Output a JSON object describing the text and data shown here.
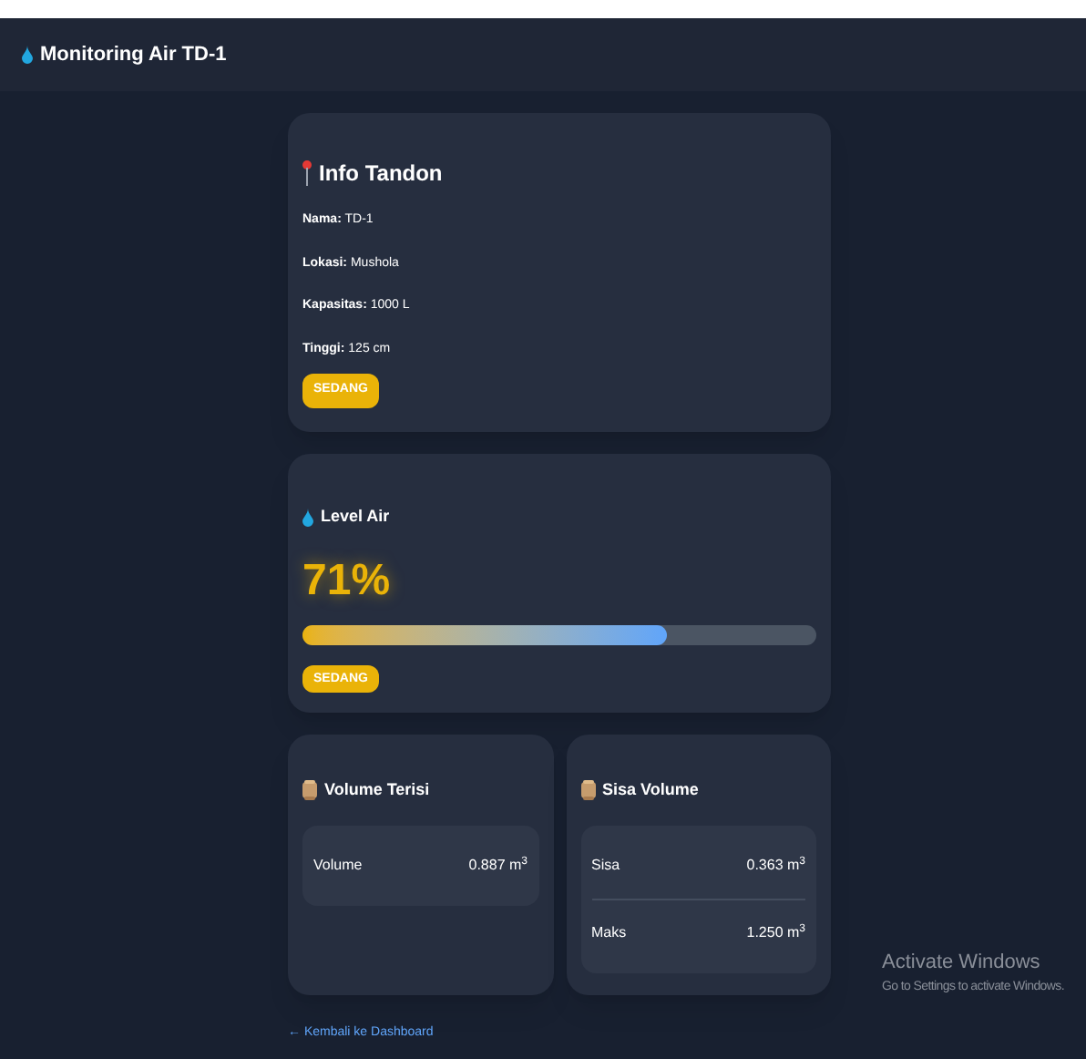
{
  "header": {
    "title": "Monitoring Air TD-1"
  },
  "info": {
    "title": "Info Tandon",
    "fields": [
      {
        "label": "Nama:",
        "value": "TD-1"
      },
      {
        "label": "Lokasi:",
        "value": "Mushola"
      },
      {
        "label": "Kapasitas:",
        "value": "1000 L"
      },
      {
        "label": "Tinggi:",
        "value": "125 cm"
      }
    ],
    "badge": "SEDANG"
  },
  "level": {
    "title": "Level Air",
    "percent": "71%",
    "level": 0.71,
    "badge": "SEDANG"
  },
  "volume_filled": {
    "title": "Volume Terisi",
    "rows": [
      {
        "label": "Volume",
        "value": "0.887 m$^{3}$"
      }
    ]
  },
  "volume_remaining": {
    "title": "Sisa Volume",
    "rows": [
      {
        "label": "Sisa",
        "value": "0.363 m$^{3}$"
      },
      {
        "label": "Maks",
        "value": "1.250 m$^{3}$"
      }
    ]
  },
  "back_link": "← Kembali ke Dashboard",
  "os_notice": {
    "title": "Activate Windows",
    "subtitle": "Go to Settings to activate Windows."
  }
}
